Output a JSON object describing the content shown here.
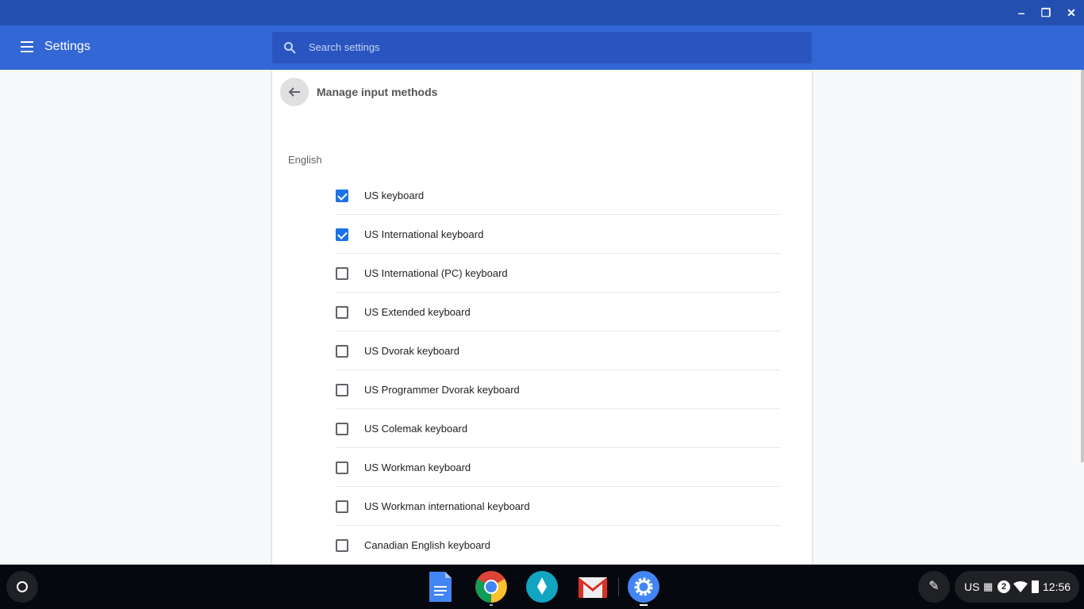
{
  "window": {
    "minimize": "‒",
    "restore": "❐",
    "close": "✕"
  },
  "header": {
    "title": "Settings",
    "search_placeholder": "Search settings"
  },
  "page": {
    "title": "Manage input methods",
    "language": "English",
    "items": [
      {
        "label": "US keyboard",
        "checked": true
      },
      {
        "label": "US International keyboard",
        "checked": true
      },
      {
        "label": "US International (PC) keyboard",
        "checked": false
      },
      {
        "label": "US Extended keyboard",
        "checked": false
      },
      {
        "label": "US Dvorak keyboard",
        "checked": false
      },
      {
        "label": "US Programmer Dvorak keyboard",
        "checked": false
      },
      {
        "label": "US Colemak keyboard",
        "checked": false
      },
      {
        "label": "US Workman keyboard",
        "checked": false
      },
      {
        "label": "US Workman international keyboard",
        "checked": false
      },
      {
        "label": "Canadian English keyboard",
        "checked": false
      }
    ]
  },
  "tray": {
    "ime": "US",
    "notifications": "2",
    "time": "12:56"
  },
  "colors": {
    "titlebar": "#2350b0",
    "header": "#3367d6",
    "accent": "#1a73e8"
  }
}
